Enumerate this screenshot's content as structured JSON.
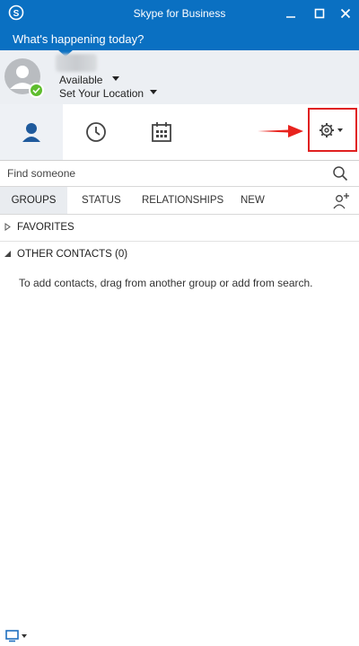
{
  "window": {
    "title": "Skype for Business",
    "minimize_label": "Minimize",
    "maximize_label": "Maximize",
    "close_label": "Close"
  },
  "banner": {
    "text": "What's happening today?"
  },
  "profile": {
    "status": "Available",
    "location": "Set Your Location",
    "presence_color": "#5ebd2e"
  },
  "tabs": [
    {
      "icon": "person-icon",
      "active": true
    },
    {
      "icon": "clock-icon",
      "active": false
    },
    {
      "icon": "calendar-icon",
      "active": false
    }
  ],
  "options": {
    "icon": "gear-icon",
    "highlight_color": "#e02020"
  },
  "search": {
    "placeholder": "Find someone",
    "value": ""
  },
  "subtabs": {
    "groups": "GROUPS",
    "status": "STATUS",
    "relationships": "RELATIONSHIPS",
    "new": "NEW"
  },
  "groups": {
    "favorites": "FAVORITES",
    "other_contacts": "OTHER CONTACTS (0)"
  },
  "empty_message": "To add contacts, drag from another group or add from search.",
  "colors": {
    "brand": "#0a70c2",
    "accent_person": "#1f5a9c"
  }
}
